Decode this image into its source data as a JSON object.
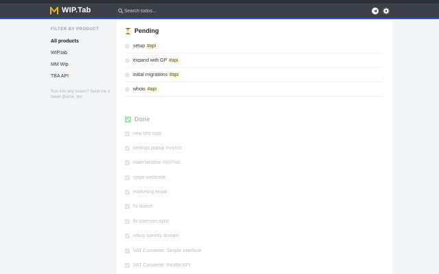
{
  "header": {
    "logo": "WIP.Tab",
    "search_placeholder": "Search todos..."
  },
  "sidebar": {
    "title": "FILTER BY PRODUCT",
    "items": [
      {
        "label": "All products",
        "active": true
      },
      {
        "label": "WIP.tab",
        "active": false
      },
      {
        "label": "MM Wip",
        "active": false
      },
      {
        "label": "TBA API",
        "active": false
      }
    ],
    "help": "Run into any issues? Send me a tweet @arne_bm"
  },
  "pending": {
    "title": "Pending",
    "items": [
      {
        "text": "setup",
        "tag": "#api"
      },
      {
        "text": "expand with GP",
        "tag": "#api"
      },
      {
        "text": "initial migrations",
        "tag": "#api"
      },
      {
        "text": "whois",
        "tag": "#api"
      }
    ]
  },
  "done": {
    "title": "Done",
    "items": [
      {
        "text": "new test todo",
        "tag": ""
      },
      {
        "text": "settings popup",
        "tag": "#wiptab"
      },
      {
        "text": "main window",
        "tag": "#WIPtab"
      },
      {
        "text": "stripe webhook",
        "tag": ""
      },
      {
        "text": "marketing email",
        "tag": ""
      },
      {
        "text": "fix queue",
        "tag": ""
      },
      {
        "text": "fix intercom sync",
        "tag": ""
      },
      {
        "text": "rebuy speedy domain",
        "tag": ""
      },
      {
        "text": "VAT Converter: Simple interface",
        "tag": ""
      },
      {
        "text": "VAT Converter: throttle API",
        "tag": ""
      }
    ]
  },
  "colors": {
    "header_bg": "#3c4049",
    "accent": "#2a56c6",
    "tag_highlight": "#fdf6c4",
    "done_check": "#a8e6b0"
  }
}
